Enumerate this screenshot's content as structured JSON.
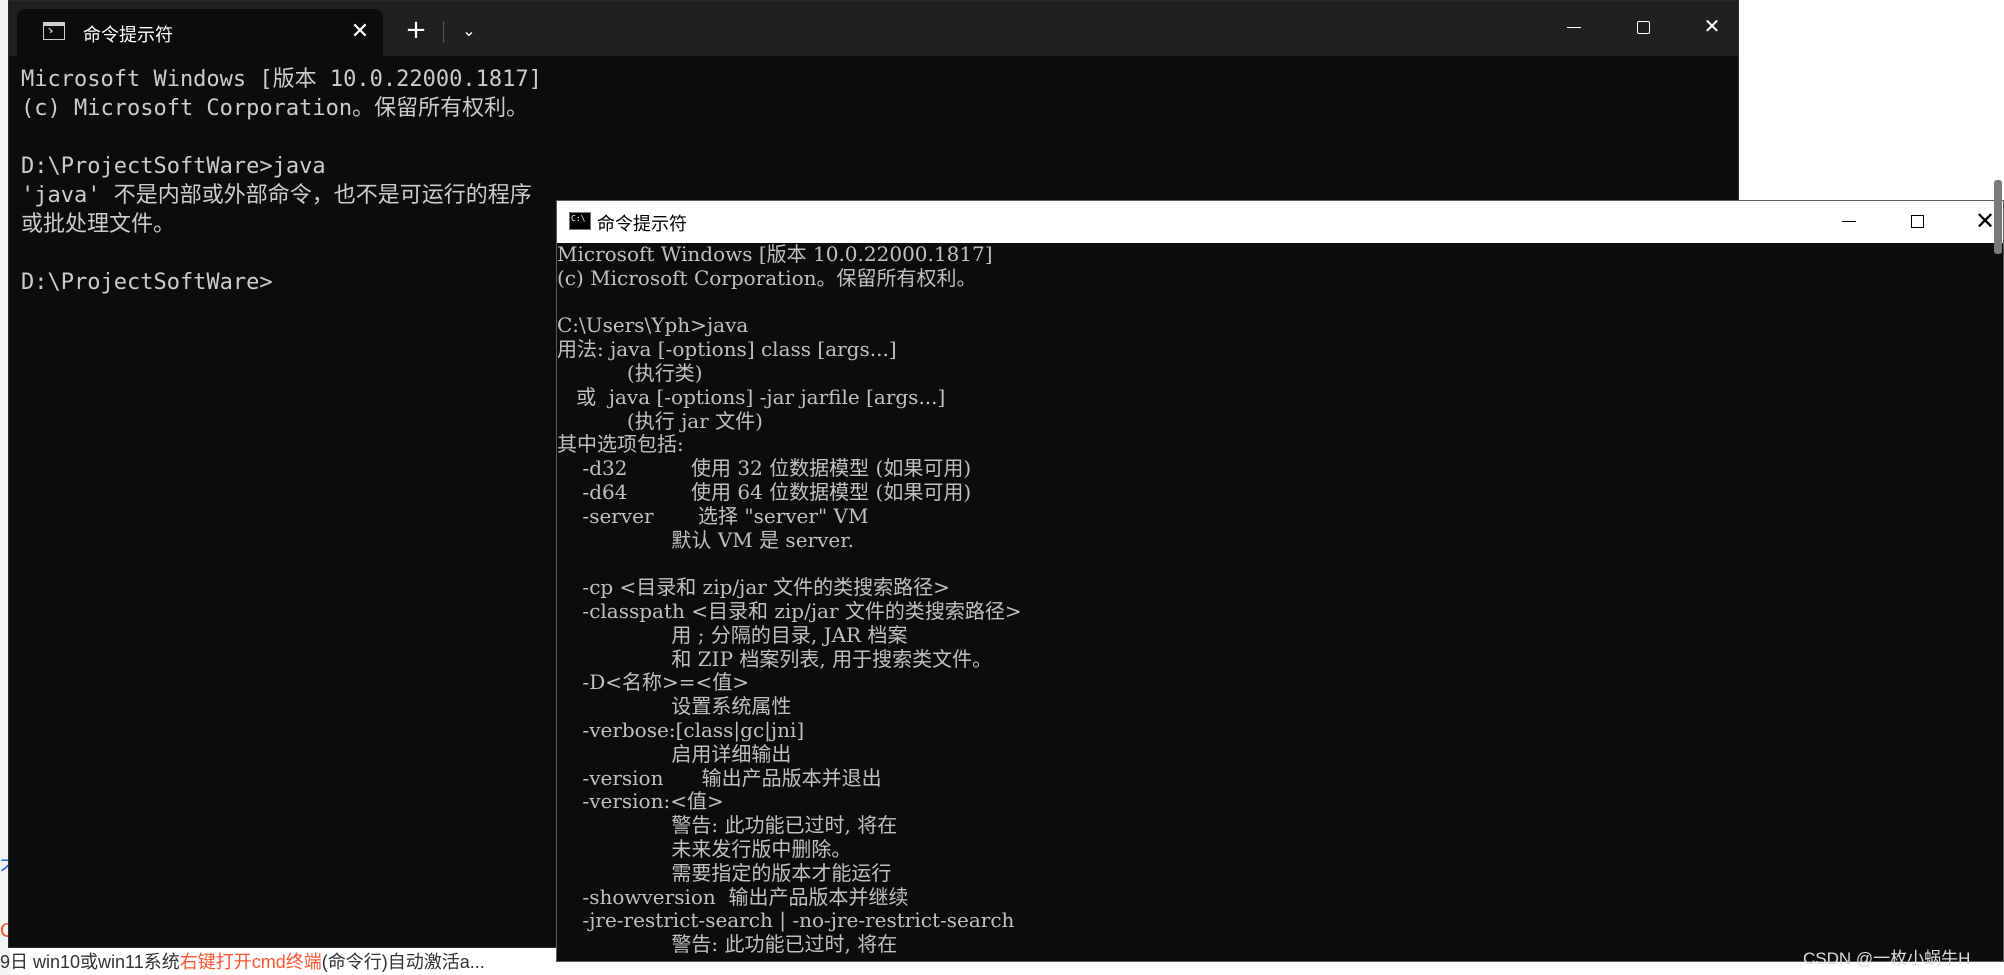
{
  "background": {
    "footer_prefix": "9日 ",
    "footer_plain": "win10或win11系统",
    "footer_red": "右键打开cmd终端",
    "footer_suffix": "(命令行)自动激活a...",
    "left_link": "不",
    "left_red": "C"
  },
  "terminal": {
    "tab_title": "命令提示符",
    "tab_close": "✕",
    "new_tab": "+",
    "dropdown": "⌄",
    "close_glyph": "✕",
    "lines": [
      "Microsoft Windows [版本 10.0.22000.1817]",
      "(c) Microsoft Corporation。保留所有权利。",
      "",
      "D:\\ProjectSoftWare>java",
      "'java' 不是内部或外部命令，也不是可运行的程序",
      "或批处理文件。",
      "",
      "D:\\ProjectSoftWare>"
    ]
  },
  "cmd": {
    "title": "命令提示符",
    "close_glyph": "✕",
    "lines": [
      "Microsoft Windows [版本 10.0.22000.1817]",
      "(c) Microsoft Corporation。保留所有权利。",
      "",
      "C:\\Users\\Yph>java",
      "用法: java [-options] class [args...]",
      "           (执行类)",
      "   或  java [-options] -jar jarfile [args...]",
      "           (执行 jar 文件)",
      "其中选项包括:",
      "    -d32          使用 32 位数据模型 (如果可用)",
      "    -d64          使用 64 位数据模型 (如果可用)",
      "    -server       选择 \"server\" VM",
      "                  默认 VM 是 server.",
      "",
      "    -cp <目录和 zip/jar 文件的类搜索路径>",
      "    -classpath <目录和 zip/jar 文件的类搜索路径>",
      "                  用 ; 分隔的目录, JAR 档案",
      "                  和 ZIP 档案列表, 用于搜索类文件。",
      "    -D<名称>=<值>",
      "                  设置系统属性",
      "    -verbose:[class|gc|jni]",
      "                  启用详细输出",
      "    -version      输出产品版本并退出",
      "    -version:<值>",
      "                  警告: 此功能已过时, 将在",
      "                  未来发行版中删除。",
      "                  需要指定的版本才能运行",
      "    -showversion  输出产品版本并继续",
      "    -jre-restrict-search | -no-jre-restrict-search",
      "                  警告: 此功能已过时, 将在"
    ]
  },
  "watermark": "CSDN @一枚小蜗牛H"
}
